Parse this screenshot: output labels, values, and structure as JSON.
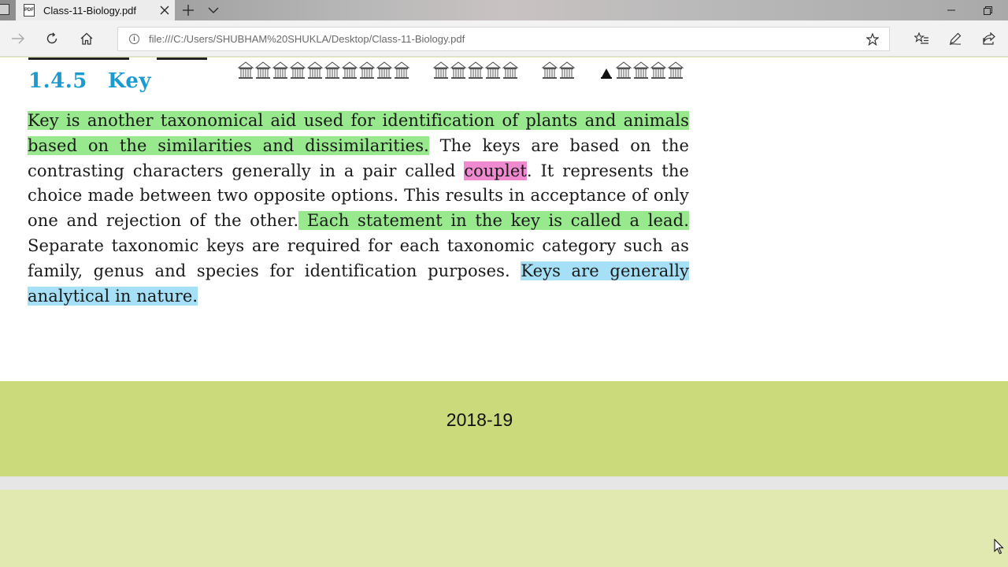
{
  "window": {
    "tab_title": "Class-11-Biology.pdf",
    "tab_icon": "pdf-icon",
    "minimize_icon": "minimize-icon",
    "restore_icon": "restore-icon"
  },
  "address_bar": {
    "url": "file:///C:/Users/SHUBHAM%20SHUKLA/Desktop/Class-11-Biology.pdf",
    "info_icon": "info-icon",
    "favorite_icon": "star-icon"
  },
  "toolbar": {
    "forward_icon": "arrow-right-icon",
    "refresh_icon": "refresh-icon",
    "home_icon": "home-icon",
    "favorites_icon": "favorites-list-icon",
    "notes_icon": "pen-icon",
    "share_icon": "share-icon"
  },
  "document": {
    "section_number": "1.4.5",
    "section_title": "Key",
    "paragraph": {
      "s1": "Key is another taxonomical aid used for identification of plants and animals based on the similarities and dissimilarities.",
      "s2a": " The keys are based on the contrasting characters generally in a pair called ",
      "couplet": "couplet",
      "s2b": ".  It represents the choice made between two opposite options. This results in acceptance of only one and rejection of the other.",
      "s3": " Each statement in the key is called a lead.",
      "s4": "  Separate taxonomic keys are required for each taxonomic category such as family, genus and species for identification purposes. ",
      "s5": "Keys are generally analytical in nature."
    },
    "highlight_colors": {
      "green": "#98e88d",
      "pink": "#ef8ad0",
      "blue": "#a6e0f6"
    },
    "heading_color": "#1b9bd0"
  },
  "footer": {
    "year": "2018-19",
    "band_color": "#cbdb7c"
  }
}
